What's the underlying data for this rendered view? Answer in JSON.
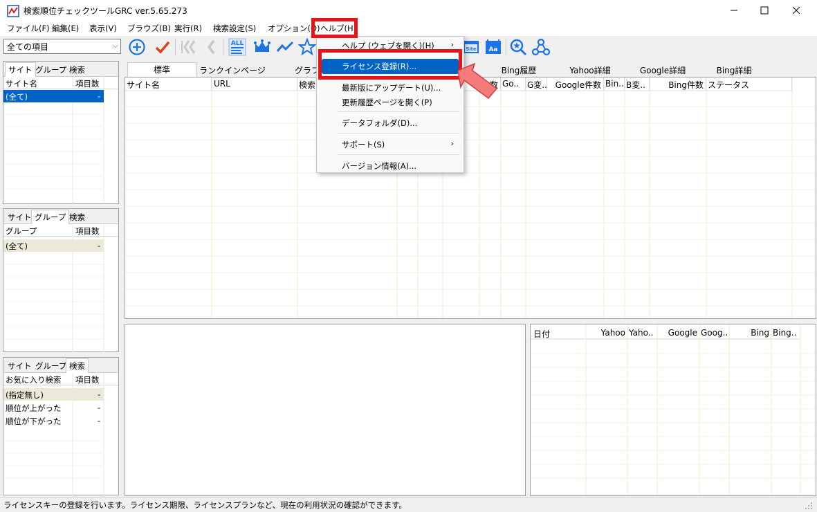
{
  "window": {
    "title": "検索順位チェックツールGRC ver.5.65.273"
  },
  "menubar": {
    "items": [
      "ファイル(F)",
      "編集(E)",
      "表示(V)",
      "ブラウズ(B)",
      "実行(R)",
      "検索設定(S)",
      "オプション(O)",
      "ヘルプ(H)"
    ]
  },
  "toolbar": {
    "combo_value": "全ての項目",
    "all_label": "ALL",
    "site_label": "Site",
    "aa_label": "Aa"
  },
  "left_panels": [
    {
      "tabs": [
        "サイト",
        "グループ",
        "検索"
      ],
      "active_tab": 0,
      "headers": [
        "サイト名",
        "項目数"
      ],
      "rows": [
        {
          "name": "(全て)",
          "count": "-"
        }
      ]
    },
    {
      "tabs": [
        "サイト",
        "グループ",
        "検索"
      ],
      "active_tab": 1,
      "headers": [
        "グループ",
        "項目数"
      ],
      "rows": [
        {
          "name": "(全て)",
          "count": "-"
        }
      ]
    },
    {
      "tabs": [
        "サイト",
        "グループ",
        "検索"
      ],
      "active_tab": 2,
      "headers": [
        "お気に入り検索",
        "項目数"
      ],
      "rows": [
        {
          "name": "(指定無し)",
          "count": "-"
        },
        {
          "name": "順位が上がった",
          "count": "-"
        },
        {
          "name": "順位が下がった",
          "count": "-"
        }
      ]
    }
  ],
  "main_tabs": [
    "標準",
    "ランクインページ",
    "グラフ",
    "",
    "",
    "Bing履歴",
    "Yahoo詳細",
    "Google詳細",
    "Bing詳細"
  ],
  "main_headers": [
    "サイト名",
    "URL",
    "検索",
    "",
    "",
    "",
    "",
    "数",
    "Go..",
    "G変..",
    "Google件数",
    "Bin..",
    "B変..",
    "Bing件数",
    "ステータス"
  ],
  "history_headers": [
    "日付",
    "Yahoo",
    "Yaho..",
    "Google",
    "Goog..",
    "Bing",
    "Bing.."
  ],
  "help_menu": {
    "items": [
      {
        "label": "ヘルプ (ウェブを開く)(H)",
        "submenu": true
      },
      {
        "label": "ライセンス登録(R)...",
        "submenu": false,
        "highlighted": true
      },
      {
        "label": "最新版にアップデート(U)...",
        "submenu": false
      },
      {
        "label": "更新履歴ページを開く(P)",
        "submenu": false
      },
      {
        "label": "データフォルダ(D)...",
        "submenu": false
      },
      {
        "label": "サポート(S)",
        "submenu": true
      },
      {
        "label": "バージョン情報(A)...",
        "submenu": false
      }
    ],
    "submenu_glyph": "›"
  },
  "status_bar": {
    "text": "ライセンスキーの登録を行います。ライセンス期限、ライセンスプランなど、現在の利用状況の確認ができます。"
  },
  "colors": {
    "highlight": "#0063c5",
    "annotation_red": "#e8141a",
    "arrow_pink": "#f47b7b",
    "icon_blue": "#1a73e8",
    "check_red": "#e03c1f"
  }
}
